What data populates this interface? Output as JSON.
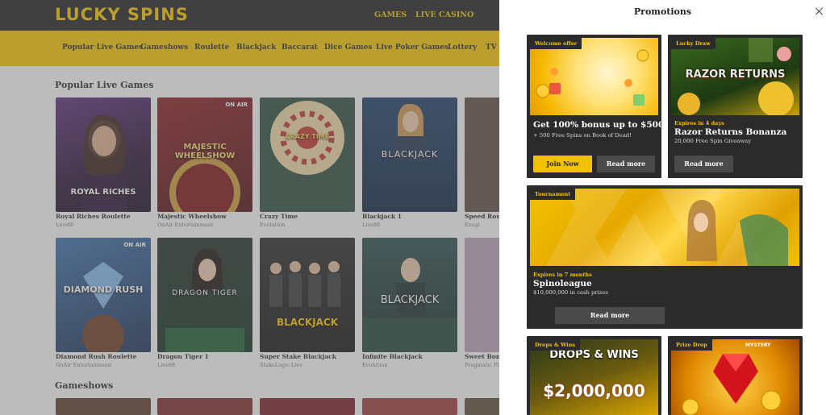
{
  "brand": {
    "logo": "LUCKY SPINS"
  },
  "topnav": [
    "GAMES",
    "LIVE CASINO"
  ],
  "categories": [
    "Popular Live Games",
    "Gameshows",
    "Roulette",
    "Blackjack",
    "Baccarat",
    "Dice Games",
    "Live Poker Games",
    "Lottery",
    "TV C"
  ],
  "sections": {
    "popular": "Popular Live Games",
    "gameshows": "Gameshows"
  },
  "games": [
    {
      "name": "Royal Riches Roulette",
      "provider": "Live88",
      "art": "ROYAL RICHES",
      "badge": ""
    },
    {
      "name": "Majestic Wheelshow",
      "provider": "OnAir Entertainment",
      "art": "MAJESTIC WHEELSHOW",
      "badge": "ON AIR"
    },
    {
      "name": "Crazy Time",
      "provider": "Evolution",
      "art": "CRAZY TIME",
      "badge": ""
    },
    {
      "name": "Blackjack 1",
      "provider": "Live88",
      "art": "BLACKJACK",
      "badge": ""
    },
    {
      "name": "Speed Rou",
      "provider": "Ezugi",
      "art": "",
      "badge": ""
    },
    {
      "name": "Diamond Rush Roulette",
      "provider": "OnAir Entertainment",
      "art": "DIAMOND RUSH",
      "badge": "ON AIR"
    },
    {
      "name": "Dragon Tiger 1",
      "provider": "Live88",
      "art": "DRAGON TIGER",
      "badge": ""
    },
    {
      "name": "Super Stake Blackjack",
      "provider": "StakeLogic Live",
      "art": "BLACKJACK",
      "badge": ""
    },
    {
      "name": "Infinite Blackjack",
      "provider": "Evolution",
      "art": "BLACKJACK",
      "badge": ""
    },
    {
      "name": "Sweet Bona",
      "provider": "Pragmatic Play",
      "art": "",
      "badge": ""
    }
  ],
  "promotions": {
    "title": "Promotions",
    "cards": [
      {
        "tag": "Welcome offer",
        "expires": "",
        "title": "Get 100% bonus up to $500",
        "subtitle": "+ 500 Free Spins on Book of Dead!",
        "primary": "Join Now",
        "secondary": "Read more"
      },
      {
        "tag": "Lucky Draw",
        "expires": "Expires in 4 days",
        "title": "Razor Returns Bonanza",
        "subtitle": "20,000 Free Spin Giveaway",
        "secondary": "Read more",
        "art": "RAZOR RETURNS"
      },
      {
        "tag": "Tournament",
        "expires": "Expires in 7 months",
        "title": "Spinoleague",
        "subtitle": "$10,000,000 in cash prizes",
        "secondary": "Read more"
      },
      {
        "tag": "Drops & Wins",
        "art": "DROPS & WINS",
        "art2": "$2,000,000"
      },
      {
        "tag": "Prize Drop",
        "art": "MYSTERY"
      }
    ]
  },
  "colors": {
    "brand_yellow": "#f2c200",
    "dark": "#2b2b2b",
    "topbar": "#1f1f1f"
  }
}
